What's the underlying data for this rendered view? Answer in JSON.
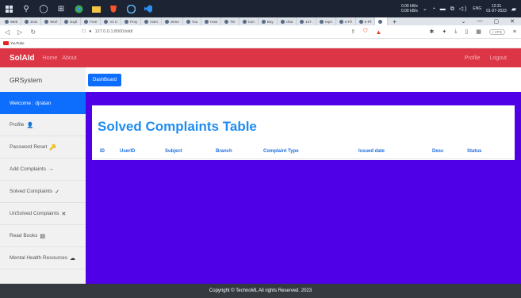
{
  "taskbar": {
    "icons": [
      "windows-icon",
      "search-icon",
      "chrome-icon",
      "task-view-icon",
      "brave-icon",
      "file-explorer-icon",
      "brave-red-icon",
      "chrome-icon",
      "vscode-icon"
    ],
    "network_top": "0.00 kB/s",
    "network_bottom": "0.00 kB/s",
    "language": "ENG",
    "time": "12:31",
    "date": "01-07-2023"
  },
  "browser": {
    "tabs": [
      "Web",
      "Jiosi",
      "Worl",
      "Expl",
      "Free",
      "Vs C",
      "Proy",
      "Hom",
      "viene",
      "You",
      "How",
      "Ter",
      "Con",
      "Buy",
      "chat",
      "127.",
      "repo",
      "e-Fil",
      "e-Fil",
      ""
    ],
    "address": "127.0.0.1:8000/slid/",
    "vpn_label": "• VPN",
    "bookmark_youtube": "YouTube"
  },
  "navbar": {
    "brand": "SolAId",
    "home": "Home",
    "about": "About",
    "profile": "Profile",
    "logout": "Logout"
  },
  "sidebar": {
    "title": "GRSystem",
    "welcome": "Welcome : djratan",
    "items": [
      {
        "label": "Profile",
        "icon": "👤"
      },
      {
        "label": "Password Reset",
        "icon": "🔑"
      },
      {
        "label": "Add Complaints",
        "icon": "→"
      },
      {
        "label": "Solved Complaints",
        "icon": "✓"
      },
      {
        "label": "UnSolved Complaints",
        "icon": "✕"
      },
      {
        "label": "Read Books",
        "icon": "▤"
      },
      {
        "label": "Mental Health Resources",
        "icon": "☁"
      }
    ]
  },
  "main": {
    "dashboard_button": "DashBoard",
    "table_title": "Solved Complaints Table",
    "columns": [
      "ID",
      "UserID",
      "Subject",
      "Branch",
      "Complaint Type",
      "Issued date",
      "Desc",
      "Status"
    ],
    "background_color": "#5000e6"
  },
  "footer": {
    "text": "Copyright © TechnoML All rights Reserved. 2023"
  },
  "colors": {
    "navbar": "#dc3545",
    "active": "#0d6efd",
    "title": "#1f8cf0",
    "footer": "#343a40"
  }
}
